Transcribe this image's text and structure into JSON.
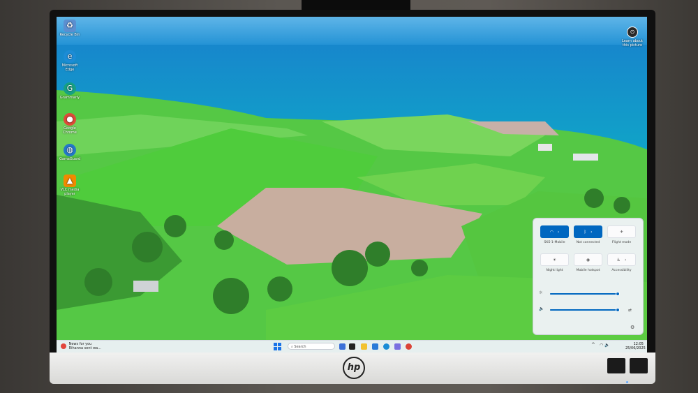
{
  "desktop": {
    "icons": [
      {
        "name": "recycle-bin-icon",
        "label": "Recycle Bin",
        "color": "#5b8fd0",
        "glyph": "♻"
      },
      {
        "name": "microsoft-edge-icon",
        "label": "Microsoft Edge",
        "color": "#1c8cd6",
        "glyph": "e"
      },
      {
        "name": "grammarly-icon",
        "label": "Grammarly",
        "color": "#16a085",
        "glyph": "G"
      },
      {
        "name": "google-chrome-icon",
        "label": "Google Chrome",
        "color": "#dd4b39",
        "glyph": "●"
      },
      {
        "name": "gamaguard-icon",
        "label": "GamaGuard",
        "color": "#2478c8",
        "glyph": "◍"
      },
      {
        "name": "vlc-icon",
        "label": "VLC media player",
        "color": "#f08a00",
        "glyph": "▲"
      }
    ],
    "learn_more": {
      "label": "Learn about this picture",
      "glyph": "⊙"
    }
  },
  "taskbar": {
    "news_title": "News for you",
    "news_sub": "Rihanna sent wa...",
    "search_placeholder": "Search",
    "clock_time": "12:05",
    "clock_date": "25/06/2025",
    "apps": [
      {
        "name": "task-view-icon",
        "color": "#3b6fd8"
      },
      {
        "name": "terminal-icon",
        "color": "#222222"
      },
      {
        "name": "file-explorer-icon",
        "color": "#f2c230"
      },
      {
        "name": "store-icon",
        "color": "#2a7ad8"
      },
      {
        "name": "edge-taskbar-icon",
        "color": "#1c8cd6"
      },
      {
        "name": "settings-taskbar-icon",
        "color": "#7b6fe0"
      },
      {
        "name": "chrome-taskbar-icon",
        "color": "#db4437"
      }
    ]
  },
  "quick_settings": {
    "tiles": [
      {
        "name": "wifi-tile",
        "label": "SKS-1-Mobile",
        "state": "on",
        "glyph": "◠"
      },
      {
        "name": "bluetooth-tile",
        "label": "Not connected",
        "state": "on",
        "glyph": "ᛒ"
      },
      {
        "name": "flight-mode-tile",
        "label": "Flight mode",
        "state": "off",
        "glyph": "✈"
      },
      {
        "name": "night-light-tile",
        "label": "Night light",
        "state": "off",
        "glyph": "☀"
      },
      {
        "name": "mobile-hotspot-tile",
        "label": "Mobile hotspot",
        "state": "off",
        "glyph": "◉"
      },
      {
        "name": "accessibility-tile",
        "label": "Accessibility",
        "state": "off",
        "glyph": "♿"
      }
    ],
    "brightness": 0.97,
    "volume": 0.97
  },
  "colors": {
    "accent": "#0067c0",
    "sky": "#3e9ed8",
    "sea": "#0f7fc0",
    "field": "#4cc63f"
  }
}
